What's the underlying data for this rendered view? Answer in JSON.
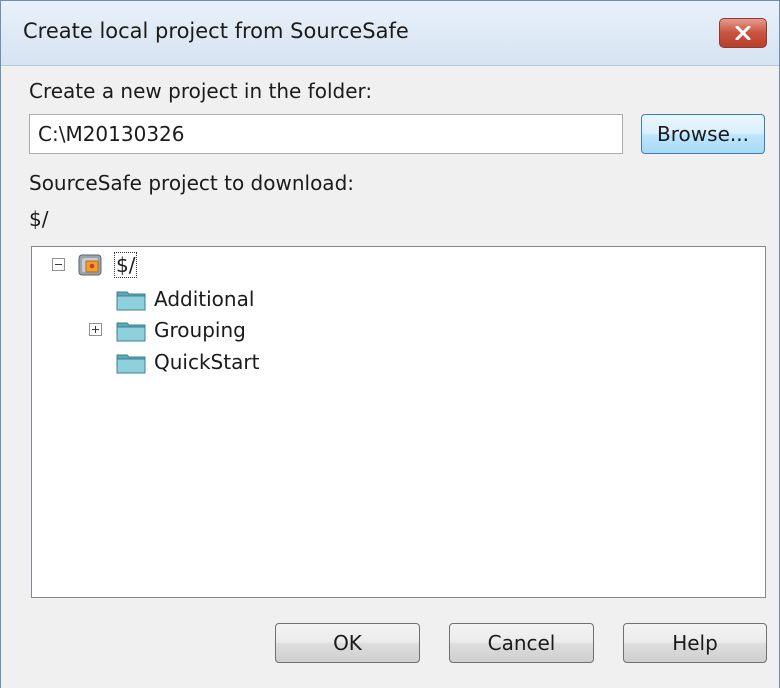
{
  "window": {
    "title": "Create local project from SourceSafe"
  },
  "folder": {
    "label": "Create a new project in the folder:",
    "value": "C:\\M20130326",
    "browse_label": "Browse..."
  },
  "project": {
    "label": "SourceSafe project to download:",
    "current": "$/"
  },
  "tree": {
    "root": {
      "label": "$/",
      "expander": "collapse",
      "icon": "database-icon"
    },
    "items": [
      {
        "label": "Additional",
        "icon": "folder-icon"
      },
      {
        "label": "Grouping",
        "icon": "folder-icon",
        "expander": "expand"
      },
      {
        "label": "QuickStart",
        "icon": "folder-icon"
      }
    ]
  },
  "buttons": {
    "ok": "OK",
    "cancel": "Cancel",
    "help": "Help"
  },
  "colors": {
    "title_bar": "#dce8f5",
    "close_button": "#c8533e",
    "folder": "#6fb8c8",
    "default_button_border": "#3c7fb1"
  }
}
